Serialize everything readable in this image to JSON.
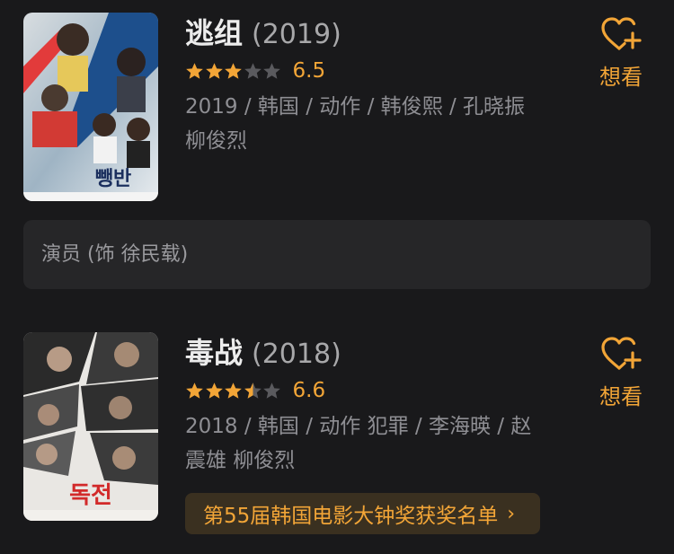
{
  "movies": [
    {
      "title": "逃组",
      "year": "(2019)",
      "rating": 6.5,
      "stars_filled": 3,
      "stars_half": 0,
      "score": "6.5",
      "meta": "2019 / 韩国 / 动作 / 韩俊熙 / 孔晓振 柳俊烈",
      "want_label": "想看",
      "poster_text": "뺑반"
    },
    {
      "title": "毒战",
      "year": "(2018)",
      "rating": 6.6,
      "stars_filled": 3,
      "stars_half": 1,
      "score": "6.6",
      "meta": "2018 / 韩国 / 动作 犯罪 / 李海暎 / 赵震雄 柳俊烈",
      "want_label": "想看",
      "poster_text": "독전",
      "award": "第55届韩国电影大钟奖获奖名单",
      "award_chevron": "›"
    }
  ],
  "role": {
    "text": "演员 (饰 徐民载)"
  },
  "colors": {
    "background": "#19191b",
    "accent": "#f2a537",
    "star_empty": "#5a5a5e",
    "card": "#262628"
  },
  "icons": {
    "want": "heart-plus-icon",
    "star": "star-icon",
    "chevron": "chevron-right-icon"
  }
}
